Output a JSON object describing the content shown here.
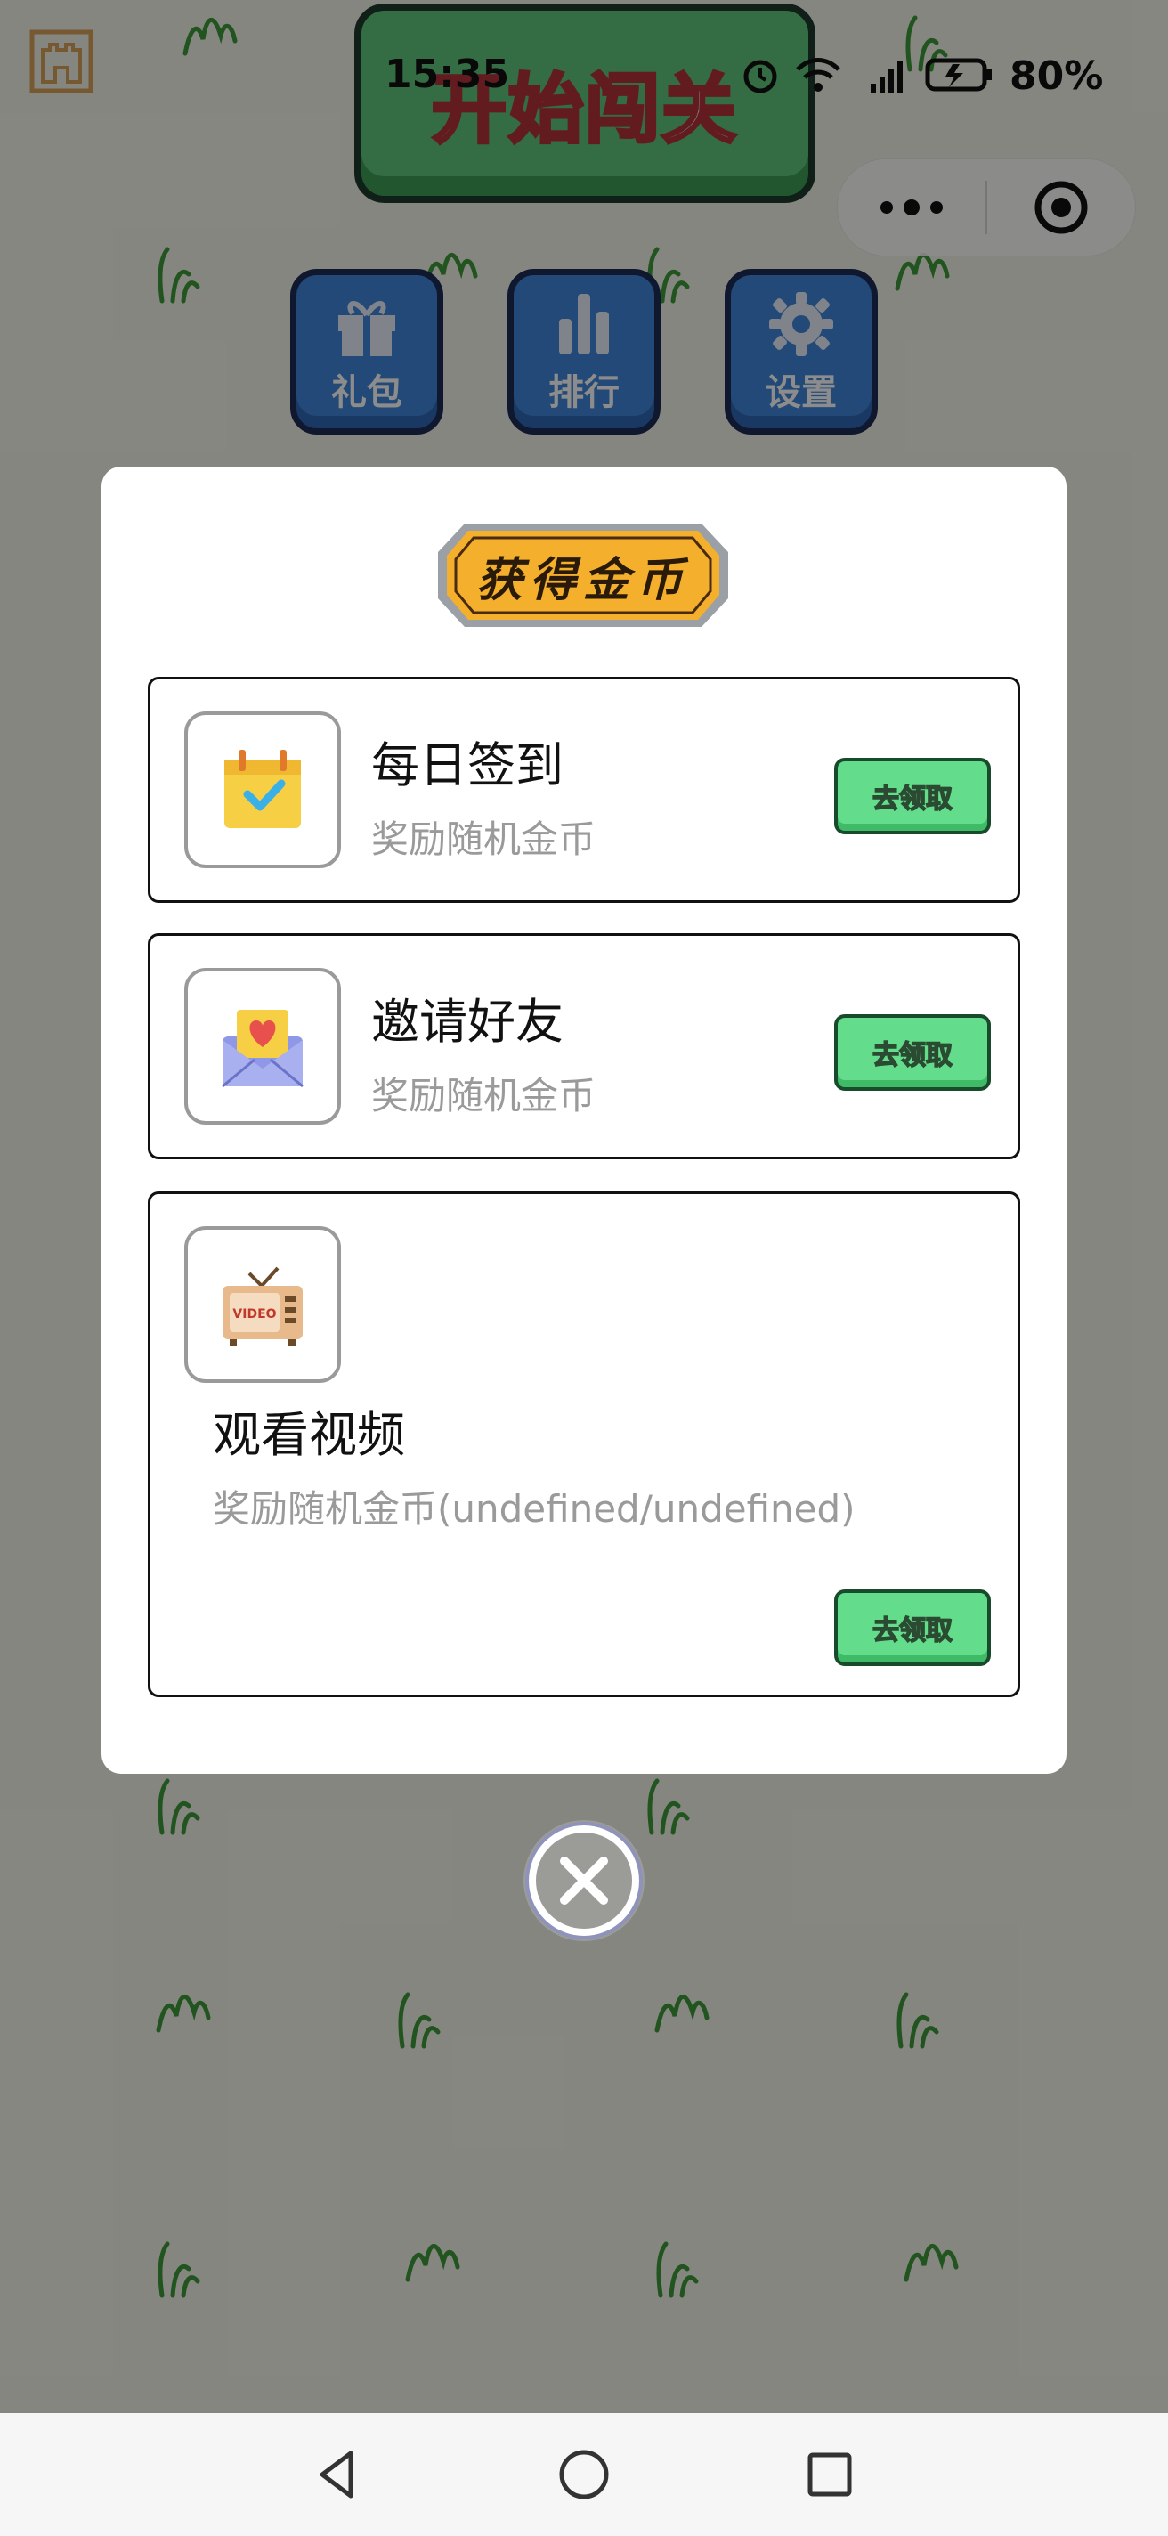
{
  "status_bar": {
    "time": "15:35",
    "battery": "80%",
    "icons": [
      "alarm-icon",
      "wifi-icon",
      "signal-5g-icon",
      "battery-icon"
    ]
  },
  "capsule": {
    "more_icon": "more-dots-icon",
    "close_icon": "target-close-icon"
  },
  "game": {
    "start_label": "开始闯关",
    "menu": [
      {
        "label": "礼包",
        "icon": "gift-icon"
      },
      {
        "label": "排行",
        "icon": "bar-chart-icon"
      },
      {
        "label": "设置",
        "icon": "gear-icon"
      }
    ]
  },
  "modal": {
    "badge_title": "获得金币",
    "tasks": [
      {
        "title": "每日签到",
        "subtitle": "奖励随机金币",
        "button": "去领取",
        "icon": "calendar-check-icon"
      },
      {
        "title": "邀请好友",
        "subtitle": "奖励随机金币",
        "button": "去领取",
        "icon": "heart-envelope-icon"
      },
      {
        "title": "观看视频",
        "subtitle": "奖励随机金币(undefined/undefined)",
        "button": "去领取",
        "icon": "video-tv-icon"
      }
    ],
    "close_icon": "close-circle-icon"
  },
  "nav": {
    "icons": [
      "back-triangle-icon",
      "home-circle-icon",
      "recents-square-icon"
    ]
  },
  "colors": {
    "claim_green": "#63dd8b",
    "menu_blue": "#3f86d9",
    "start_green": "#5fc57a",
    "badge_orange": "#f4b02c"
  }
}
